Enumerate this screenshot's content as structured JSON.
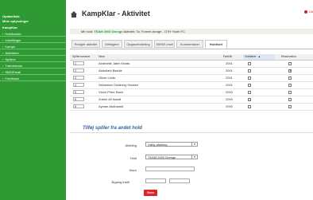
{
  "sidebar": {
    "links": [
      "Opdateliste",
      "Mine oplysninger",
      "KampKlar"
    ],
    "items": [
      {
        "label": "Holdforside"
      },
      {
        "label": "Indstillinger"
      },
      {
        "label": "Kampe"
      },
      {
        "label": "Aktiviteter"
      },
      {
        "label": "Spillere"
      },
      {
        "label": "Trænerteam"
      },
      {
        "label": "SMS/Email"
      },
      {
        "label": "Feedback"
      }
    ]
  },
  "header": {
    "title": "KampKlar - Aktivitet",
    "user_link": "Ud"
  },
  "info": {
    "prefix": "Mit hold:",
    "team": "TEAM 2000 Drenge",
    "detail": "Aktivitet: Ta. Formel Arrage - OTH Youth FC"
  },
  "tabs": [
    {
      "label": "Rediger aktivitet"
    },
    {
      "label": "Deltagere"
    },
    {
      "label": "Opgavefordeling"
    },
    {
      "label": "SMS/E-mail"
    },
    {
      "label": "Kommentarer"
    },
    {
      "label": "Holdkort"
    }
  ],
  "table": {
    "headers": {
      "number": "Spillernummer",
      "name": "Navn",
      "year": "Født/år",
      "status": "Holdfører",
      "extra": "Reservation"
    },
    "rows": [
      {
        "num": "1",
        "name": "Abdirahik Jabiri Khalis",
        "year": "2001",
        "selected": false,
        "extra": false
      },
      {
        "num": "2",
        "name": "Abdullahi Bashiir",
        "year": "2001",
        "selected": false,
        "extra": true
      },
      {
        "num": "3",
        "name": "Oliver Linds",
        "year": "2001",
        "selected": false,
        "extra": false
      },
      {
        "num": "4",
        "name": "Sebastian Goldberg Hansen",
        "year": "2001",
        "selected": false,
        "extra": false
      },
      {
        "num": "5",
        "name": "Victor Peter Bach",
        "year": "2000",
        "selected": false,
        "extra": false
      },
      {
        "num": "6",
        "name": "Zubeir Ali Ismail",
        "year": "2000",
        "selected": false,
        "extra": false
      },
      {
        "num": "8",
        "name": "Ayman Abdhamid",
        "year": "2000",
        "selected": false,
        "extra": false
      }
    ]
  },
  "form": {
    "title": "Tilføj spiller fra andet hold",
    "activity_label": "Afdeling",
    "activity_value": "Vælg afdeling",
    "team_label": "Hold",
    "team_value": "TEAM 2000 Drenge",
    "name_label": "Navn",
    "year_label": "Årgang fra/til",
    "save_label": "Gem"
  },
  "colors": {
    "sidebar": "#2f9a33",
    "accent_red": "#d9242b",
    "title_blue": "#3a5fa0"
  }
}
